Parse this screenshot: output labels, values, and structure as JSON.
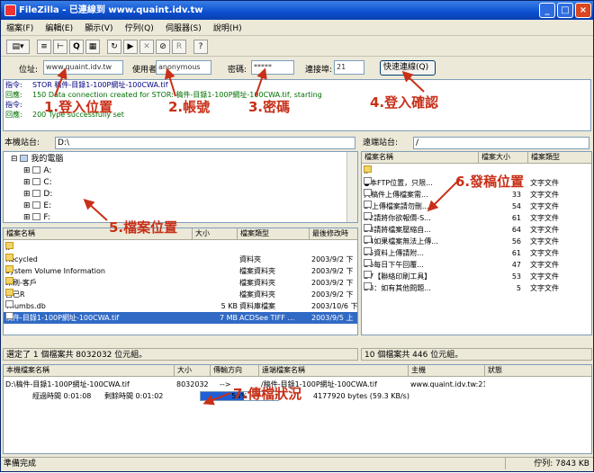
{
  "app": {
    "title": "FileZilla - 已連線到 www.quaint.idv.tw"
  },
  "menu": [
    "檔案(F)",
    "編輯(E)",
    "顯示(V)",
    "佇列(Q)",
    "伺服器(S)",
    "說明(H)"
  ],
  "quickconnect": {
    "address_label": "位址:",
    "address_value": "www.quaint.idv.tw",
    "user_label": "使用者:",
    "user_value": "anonymous",
    "password_label": "密碼:",
    "password_value": "*****",
    "port_label": "連接埠:",
    "port_value": "21",
    "connect_button": "快速連線(Q)"
  },
  "log": [
    {
      "label": "指令:",
      "text": "STOR 稿件-目錄1-100P網址-100CWA.tif",
      "kind": "cmd"
    },
    {
      "label": "回應:",
      "text": "150 Data connection created for STOR: 稿件-目錄1-100P網址-100CWA.tif, starting",
      "kind": "resp"
    },
    {
      "label": "指令:",
      "text": "",
      "kind": "cmd"
    },
    {
      "label": "回應:",
      "text": "200 Type successfully set",
      "kind": "resp"
    }
  ],
  "local": {
    "site_label": "本機站台:",
    "path": "D:\\",
    "tree": [
      "我的電腦",
      "A:",
      "C:",
      "D:",
      "E:",
      "F:"
    ],
    "columns": [
      "檔案名稱",
      "大小",
      "檔案類型",
      "最後修改時"
    ],
    "files": [
      {
        "name": "..",
        "size": "",
        "type": "",
        "modified": ""
      },
      {
        "name": "Recycled",
        "size": "",
        "type": "資料夾",
        "modified": "2003/9/2 下"
      },
      {
        "name": "System Volume Information",
        "size": "",
        "type": "檔案資料夾",
        "modified": "2003/9/2 下"
      },
      {
        "name": "印刷-客戶",
        "size": "",
        "type": "檔案資料夾",
        "modified": "2003/9/2 下"
      },
      {
        "name": "自己R",
        "size": "",
        "type": "檔案資料夾",
        "modified": "2003/9/2 下"
      },
      {
        "name": "Thumbs.db",
        "size": "5 KB",
        "type": "資料庫檔案",
        "modified": "2003/10/6 下"
      },
      {
        "name": "稿件-目錄1-100P網址-100CWA.tif",
        "size": "7 MB",
        "type": "ACDSee TIFF ...",
        "modified": "2003/9/5 上"
      }
    ],
    "status": "選定了 1 個檔案共 8032032 位元組。"
  },
  "remote": {
    "site_label": "遠端站台:",
    "path": "/",
    "columns": [
      "檔案名稱",
      "檔案大小",
      "檔案類型"
    ],
    "files": [
      {
        "name": "..",
        "size": "",
        "type": ""
      },
      {
        "name": "●本FTP位置，只限...",
        "size": "0",
        "type": "文字文件"
      },
      {
        "name": "大稿件上傳檔案需...",
        "size": "33",
        "type": "文字文件"
      },
      {
        "name": "D:上傳檔案請勿刪...",
        "size": "54",
        "type": "文字文件"
      },
      {
        "name": "D2請將你欲報價-S...",
        "size": "61",
        "type": "文字文件"
      },
      {
        "name": "D3請將檔案壓縮自...",
        "size": "64",
        "type": "文字文件"
      },
      {
        "name": "D4如果檔案無法上傳...",
        "size": "56",
        "type": "文字文件"
      },
      {
        "name": "D5資料上傳請附...",
        "size": "61",
        "type": "文字文件"
      },
      {
        "name": "D6每日下午回覆...",
        "size": "47",
        "type": "文字文件"
      },
      {
        "name": "D7【聯絡印刷工具】",
        "size": "53",
        "type": "文字文件"
      },
      {
        "name": "D8：如有其他問題...",
        "size": "5",
        "type": "文字文件"
      }
    ],
    "status": "10 個檔案共 446 位元組。"
  },
  "queue": {
    "columns": [
      "本機檔案名稱",
      "大小",
      "傳輸方向",
      "遠端檔案名稱",
      "主機",
      "狀態"
    ],
    "row": {
      "local": "D:\\稿件-目錄1-100P網址-100CWA.tif",
      "size": "8032032",
      "direction": "-->",
      "remote": "/稿件-目錄1-100P網址-100CWA.tif",
      "host": "www.quaint.idv.tw:21"
    },
    "elapsed": "經過時間 0:01:08",
    "remaining": "剩餘時間 0:01:02",
    "progress": 0.56,
    "progress_label": "56%",
    "bytes": "4177920 bytes (59.3 KB/s)"
  },
  "statusbar": {
    "left": "準備完成",
    "queue": "佇列: 7843 KB"
  },
  "annotations": [
    "1.登入位置",
    "2.帳號",
    "3.密碼",
    "4.登入確認",
    "5.檔案位置",
    "6.發稿位置",
    "7.傳檔狀況"
  ],
  "colors": {
    "annotation": "#c83018",
    "titlebar": "#0c4fcf",
    "progress": "#1f5fd6"
  }
}
